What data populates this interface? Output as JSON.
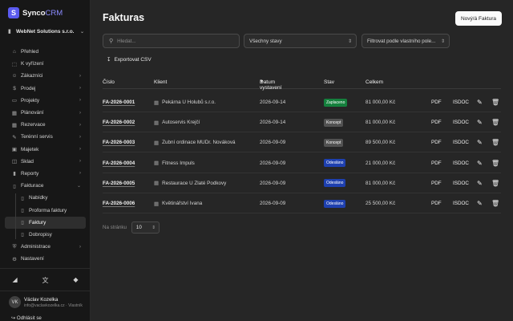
{
  "brand": {
    "name_a": "Synco",
    "name_b": "CRM",
    "logo_letter": "S",
    "accent": "#5b5bf0"
  },
  "company": {
    "name": "WebNet Solutions s.r.o."
  },
  "nav": [
    {
      "label": "Přehled",
      "icon": "home-icon",
      "chev": false
    },
    {
      "label": "K vyřízení",
      "icon": "inbox-icon",
      "chev": false
    },
    {
      "label": "Zákazníci",
      "icon": "users-icon",
      "chev": true
    },
    {
      "label": "Prodej",
      "icon": "dollar-icon",
      "chev": true
    },
    {
      "label": "Projekty",
      "icon": "folder-icon",
      "chev": true
    },
    {
      "label": "Plánování",
      "icon": "calendar-icon",
      "chev": true
    },
    {
      "label": "Rezervace",
      "icon": "calendar-check-icon",
      "chev": true
    },
    {
      "label": "Terénní servis",
      "icon": "wrench-icon",
      "chev": true
    },
    {
      "label": "Majetek",
      "icon": "briefcase-icon",
      "chev": true
    },
    {
      "label": "Sklad",
      "icon": "box-icon",
      "chev": true
    },
    {
      "label": "Reporty",
      "icon": "chart-icon",
      "chev": true
    },
    {
      "label": "Fakturace",
      "icon": "file-icon",
      "chev": true,
      "open": true
    },
    {
      "label": "Nabídky",
      "icon": "file-icon",
      "sub": true
    },
    {
      "label": "Proforma faktury",
      "icon": "file-icon",
      "sub": true
    },
    {
      "label": "Faktury",
      "icon": "file-icon",
      "sub": true,
      "active": true
    },
    {
      "label": "Dobropisy",
      "icon": "file-icon",
      "sub": true
    },
    {
      "label": "Administrace",
      "icon": "shield-icon",
      "chev": true
    },
    {
      "label": "Nastavení",
      "icon": "gear-icon",
      "chev": false
    }
  ],
  "user": {
    "initials": "VK",
    "name": "Václav Kozelka",
    "email": "info@vaclavkozelka.cz · Vlastník"
  },
  "logout": "Odhlásit se",
  "page": {
    "title": "Fakturas",
    "new_button": "Nový/á Faktura",
    "search_placeholder": "Hledat...",
    "status_filter": "Všechny stavy",
    "custom_filter": "Filtrovat podle vlastního pole...",
    "export": "Exportovat CSV"
  },
  "table": {
    "headers": {
      "number": "Číslo",
      "client": "Klient",
      "date": "Datum vystavení",
      "status": "Stav",
      "total": "Celkem"
    },
    "rows": [
      {
        "number": "FA-2026-0001",
        "client": "Pekárna U Holubů s.r.o.",
        "date": "2026-09-14",
        "status": "Zaplaceno",
        "status_color": "#15803d",
        "total": "81 000,00 Kč",
        "pdf": "PDF",
        "isdoc": "ISDOC"
      },
      {
        "number": "FA-2026-0002",
        "client": "Autoservis Krejčí",
        "date": "2026-09-14",
        "status": "Koncept",
        "status_color": "#525252",
        "total": "81 000,00 Kč",
        "pdf": "PDF",
        "isdoc": "ISDOC"
      },
      {
        "number": "FA-2026-0003",
        "client": "Zubní ordinace MUDr. Nováková",
        "date": "2026-09-09",
        "status": "Koncept",
        "status_color": "#525252",
        "total": "89 500,00 Kč",
        "pdf": "PDF",
        "isdoc": "ISDOC"
      },
      {
        "number": "FA-2026-0004",
        "client": "Fitness Impuls",
        "date": "2026-09-09",
        "status": "Odesláno",
        "status_color": "#1e40af",
        "total": "21 000,00 Kč",
        "pdf": "PDF",
        "isdoc": "ISDOC"
      },
      {
        "number": "FA-2026-0005",
        "client": "Restaurace U Zlaté Podkovy",
        "date": "2026-09-09",
        "status": "Odesláno",
        "status_color": "#1e40af",
        "total": "81 000,00 Kč",
        "pdf": "PDF",
        "isdoc": "ISDOC"
      },
      {
        "number": "FA-2026-0006",
        "client": "Květinářství Ivana",
        "date": "2026-09-09",
        "status": "Odesláno",
        "status_color": "#1e40af",
        "total": "25 500,00 Kč",
        "pdf": "PDF",
        "isdoc": "ISDOC"
      }
    ]
  },
  "pager": {
    "label": "Na stránku",
    "value": "10"
  }
}
